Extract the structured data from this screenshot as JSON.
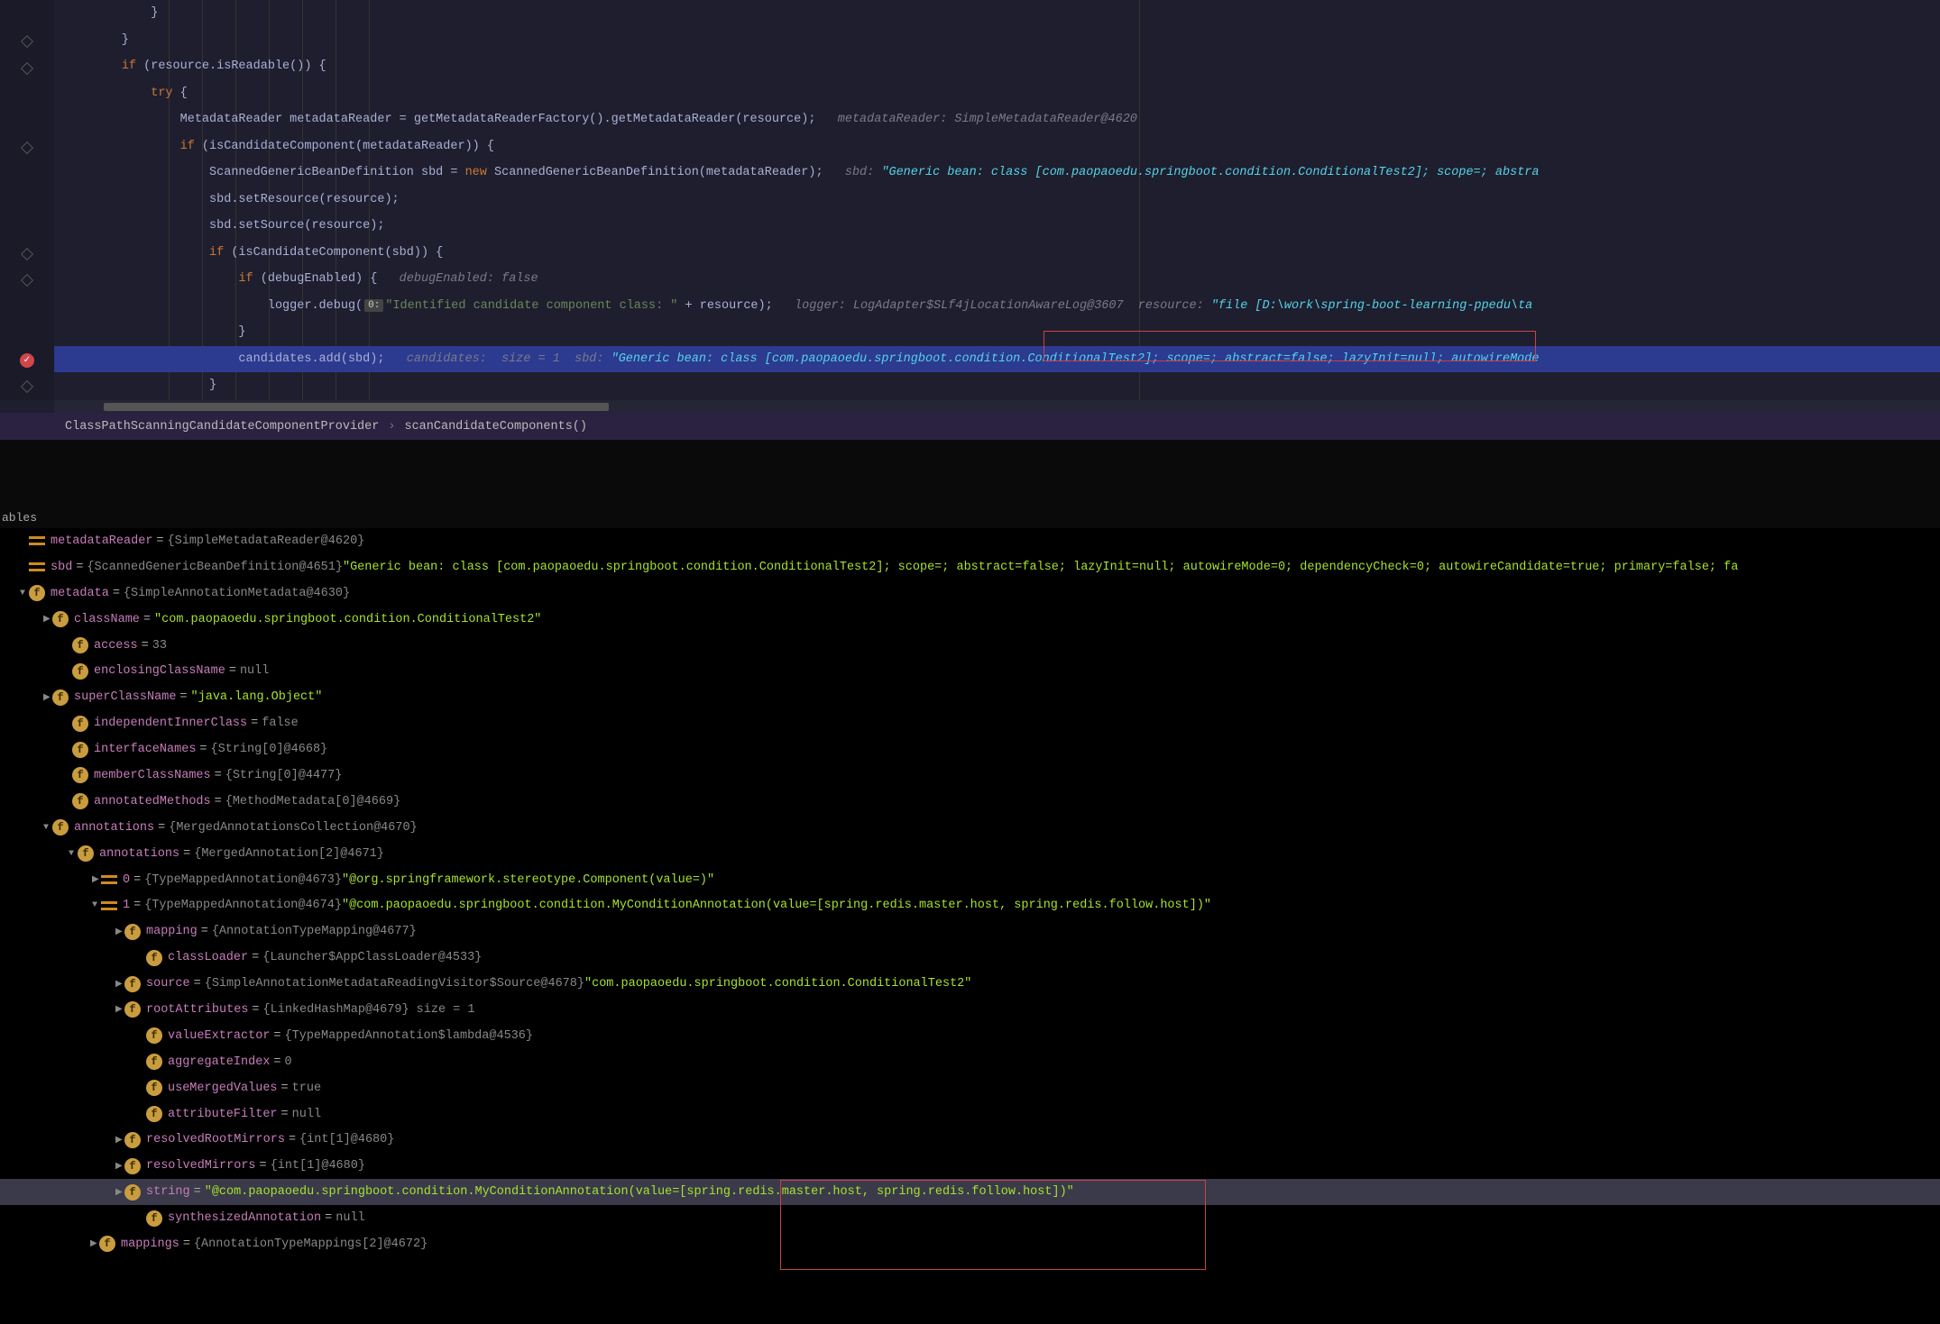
{
  "breadcrumb": {
    "item1": "ClassPathScanningCandidateComponentProvider",
    "sep": "›",
    "item2": "scanCandidateComponents()"
  },
  "vars_header": "ables",
  "code": {
    "l0": "            }",
    "l1": "        }",
    "l2a": "        ",
    "l2kw": "if",
    "l2b": " (resource.isReadable()) {",
    "l3a": "            ",
    "l3kw": "try",
    "l3b": " {",
    "l4a": "                MetadataReader metadataReader = getMetadataReaderFactory().getMetadataReader(resource);   ",
    "l4c": "metadataReader: SimpleMetadataReader@4620",
    "l5a": "                ",
    "l5kw": "if",
    "l5b": " (isCandidateComponent(metadataReader)) {",
    "l6a": "                    ScannedGenericBeanDefinition sbd = ",
    "l6kw": "new",
    "l6b": " ScannedGenericBeanDefinition(metadataReader);   ",
    "l6c": "sbd: ",
    "l6d": "\"Generic bean: class [com.paopaoedu.springboot.condition.ConditionalTest2]; scope=; abstra",
    "l7": "                    sbd.setResource(resource);",
    "l8": "                    sbd.setSource(resource);",
    "l9a": "                    ",
    "l9kw": "if",
    "l9b": " (isCandidateComponent(sbd)) {",
    "l10a": "                        ",
    "l10kw": "if",
    "l10b": " (debugEnabled) {   ",
    "l10c": "debugEnabled: false",
    "l11a": "                            logger.debug(",
    "l11badge": "0:",
    "l11b": "\"Identified candidate component class: \"",
    "l11c": " + resource);   ",
    "l11d": "logger: LogAdapter$SLf4jLocationAwareLog@3607  resource: ",
    "l11e": "\"file [D:\\work\\spring-boot-learning-ppedu\\ta",
    "l12": "                        }",
    "l13a": "                        candidates.add(sbd);   ",
    "l13b": "candidates:  size = 1  sbd: ",
    "l13c": "\"Generic bean: class [com.paopaoedu.springboot.condition.ConditionalTest2]; ",
    "l13d": "scope=; abstract=false; lazyInit=null; autowireMode",
    "l14": "                    }"
  },
  "vars": [
    {
      "ind": 22,
      "tri": "",
      "ic": "eq",
      "name": "metadataReader",
      "eq": " = ",
      "gray": "{SimpleMetadataReader@4620}",
      "val": ""
    },
    {
      "ind": 22,
      "tri": "",
      "ic": "eq",
      "name": "sbd",
      "eq": " = ",
      "gray": "{ScannedGenericBeanDefinition@4651} ",
      "val": "\"Generic bean: class [com.paopaoedu.springboot.condition.ConditionalTest2]; scope=; abstract=false; lazyInit=null; autowireMode=0; dependencyCheck=0; autowireCandidate=true; primary=false; fa"
    },
    {
      "ind": 22,
      "tri": "▼",
      "ic": "f",
      "name": "metadata",
      "eq": " = ",
      "gray": "{SimpleAnnotationMetadata@4630}",
      "val": ""
    },
    {
      "ind": 48,
      "tri": "▶",
      "ic": "f",
      "name": "className",
      "eq": " = ",
      "gray": "",
      "val": "\"com.paopaoedu.springboot.condition.ConditionalTest2\""
    },
    {
      "ind": 70,
      "tri": "",
      "ic": "f",
      "name": "access",
      "eq": " = ",
      "gray": "33",
      "val": ""
    },
    {
      "ind": 70,
      "tri": "",
      "ic": "f",
      "name": "enclosingClassName",
      "eq": " = ",
      "gray": "null",
      "val": ""
    },
    {
      "ind": 48,
      "tri": "▶",
      "ic": "f",
      "name": "superClassName",
      "eq": " = ",
      "gray": "",
      "val": "\"java.lang.Object\""
    },
    {
      "ind": 70,
      "tri": "",
      "ic": "f",
      "name": "independentInnerClass",
      "eq": " = ",
      "gray": "false",
      "val": ""
    },
    {
      "ind": 70,
      "tri": "",
      "ic": "f",
      "name": "interfaceNames",
      "eq": " = ",
      "gray": "{String[0]@4668}",
      "val": ""
    },
    {
      "ind": 70,
      "tri": "",
      "ic": "f",
      "name": "memberClassNames",
      "eq": " = ",
      "gray": "{String[0]@4477}",
      "val": ""
    },
    {
      "ind": 70,
      "tri": "",
      "ic": "f",
      "name": "annotatedMethods",
      "eq": " = ",
      "gray": "{MethodMetadata[0]@4669}",
      "val": ""
    },
    {
      "ind": 48,
      "tri": "▼",
      "ic": "f",
      "name": "annotations",
      "eq": " = ",
      "gray": "{MergedAnnotationsCollection@4670}",
      "val": ""
    },
    {
      "ind": 76,
      "tri": "▼",
      "ic": "f",
      "name": "annotations",
      "eq": " = ",
      "gray": "{MergedAnnotation[2]@4671}",
      "val": ""
    },
    {
      "ind": 102,
      "tri": "▶",
      "ic": "eq",
      "name": "0",
      "eq": " = ",
      "gray": "{TypeMappedAnnotation@4673} ",
      "val": "\"@org.springframework.stereotype.Component(value=)\""
    },
    {
      "ind": 102,
      "tri": "▼",
      "ic": "eq",
      "name": "1",
      "eq": " = ",
      "gray": "{TypeMappedAnnotation@4674} ",
      "val": "\"@com.paopaoedu.springboot.condition.MyConditionAnnotation(value=[spring.redis.master.host, spring.redis.follow.host])\""
    },
    {
      "ind": 128,
      "tri": "▶",
      "ic": "f",
      "name": "mapping",
      "eq": " = ",
      "gray": "{AnnotationTypeMapping@4677}",
      "val": ""
    },
    {
      "ind": 152,
      "tri": "",
      "ic": "f",
      "name": "classLoader",
      "eq": " = ",
      "gray": "{Launcher$AppClassLoader@4533}",
      "val": ""
    },
    {
      "ind": 128,
      "tri": "▶",
      "ic": "f",
      "name": "source",
      "eq": " = ",
      "gray": "{SimpleAnnotationMetadataReadingVisitor$Source@4678} ",
      "val": "\"com.paopaoedu.springboot.condition.ConditionalTest2\""
    },
    {
      "ind": 128,
      "tri": "▶",
      "ic": "f",
      "name": "rootAttributes",
      "eq": " = ",
      "gray": "{LinkedHashMap@4679}  size = 1",
      "val": ""
    },
    {
      "ind": 152,
      "tri": "",
      "ic": "f",
      "name": "valueExtractor",
      "eq": " = ",
      "gray": "{TypeMappedAnnotation$lambda@4536}",
      "val": ""
    },
    {
      "ind": 152,
      "tri": "",
      "ic": "f",
      "name": "aggregateIndex",
      "eq": " = ",
      "gray": "0",
      "val": ""
    },
    {
      "ind": 152,
      "tri": "",
      "ic": "f",
      "name": "useMergedValues",
      "eq": " = ",
      "gray": "true",
      "val": ""
    },
    {
      "ind": 152,
      "tri": "",
      "ic": "f",
      "name": "attributeFilter",
      "eq": " = ",
      "gray": "null",
      "val": ""
    },
    {
      "ind": 128,
      "tri": "▶",
      "ic": "f",
      "name": "resolvedRootMirrors",
      "eq": " = ",
      "gray": "{int[1]@4680}",
      "val": ""
    },
    {
      "ind": 128,
      "tri": "▶",
      "ic": "f",
      "name": "resolvedMirrors",
      "eq": " = ",
      "gray": "{int[1]@4680}",
      "val": ""
    },
    {
      "ind": 128,
      "tri": "▶",
      "ic": "f",
      "name": "string",
      "eq": " = ",
      "gray": "",
      "val": "\"@com.paopaoedu.springboot.condition.MyConditionAnnotation(value=[spring.redis.master.host, spring.redis.follow.host])\"",
      "sel": true
    },
    {
      "ind": 152,
      "tri": "",
      "ic": "f",
      "name": "synthesizedAnnotation",
      "eq": " = ",
      "gray": "null",
      "val": ""
    },
    {
      "ind": 100,
      "tri": "▶",
      "ic": "f",
      "name": "mappings",
      "eq": " = ",
      "gray": "{AnnotationTypeMappings[2]@4672}",
      "val": ""
    }
  ]
}
